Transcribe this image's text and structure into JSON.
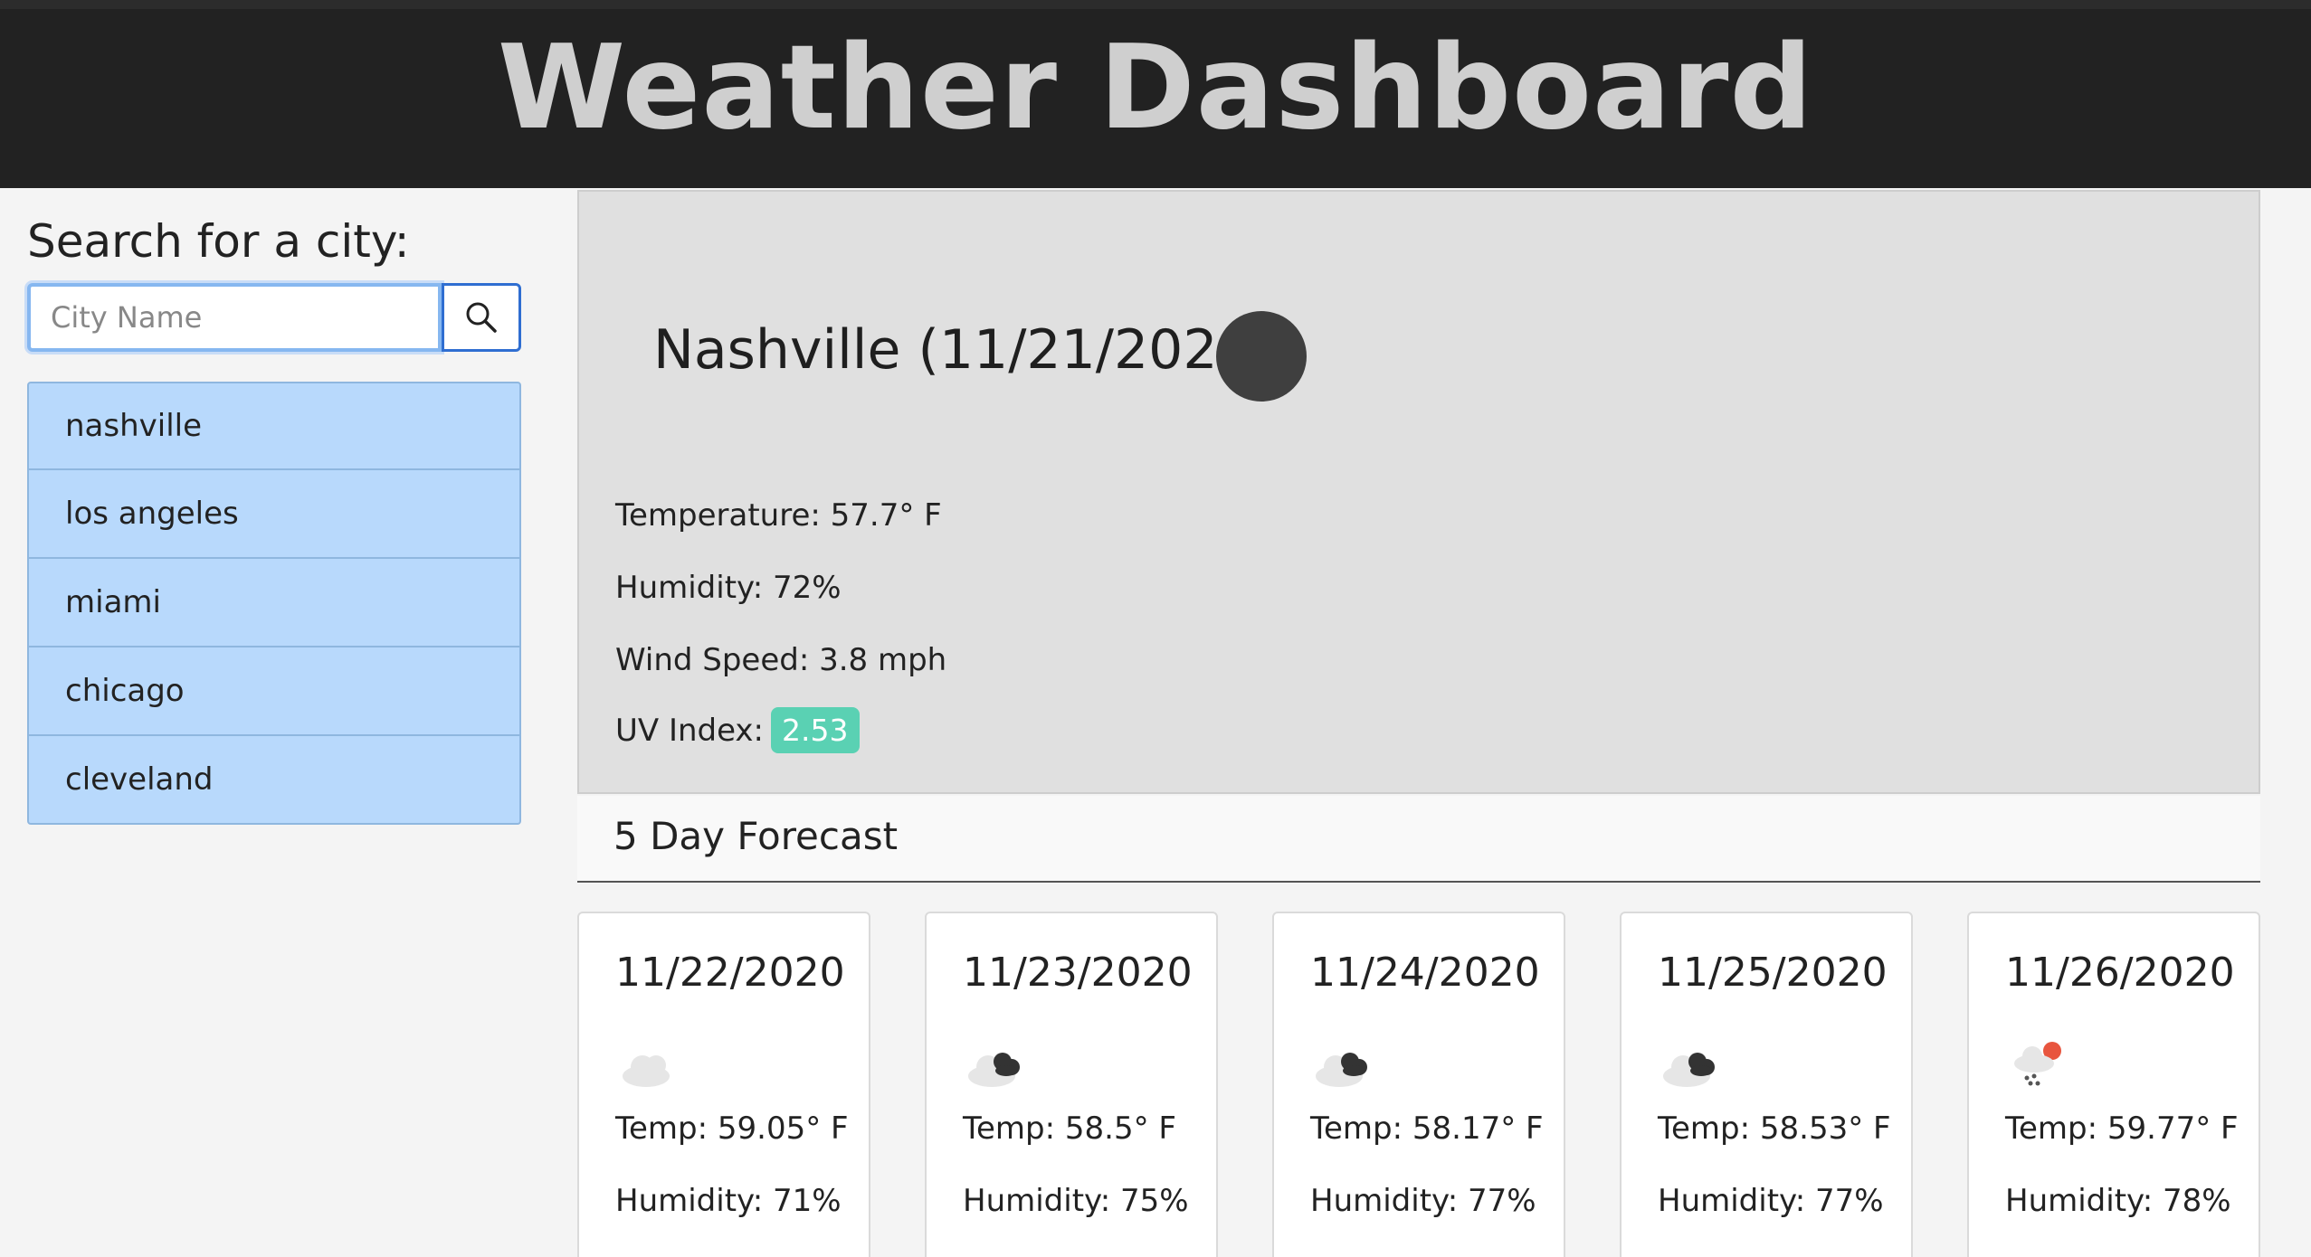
{
  "header": {
    "title": "Weather Dashboard"
  },
  "search": {
    "label": "Search for a city:",
    "placeholder": "City Name",
    "value": ""
  },
  "history": [
    {
      "label": "nashville"
    },
    {
      "label": "los angeles"
    },
    {
      "label": "miami"
    },
    {
      "label": "chicago"
    },
    {
      "label": "cleveland"
    }
  ],
  "current": {
    "title": "Nashville (11/21/2020)",
    "icon": "weather-icon",
    "temperature": "Temperature: 57.7° F",
    "humidity": "Humidity: 72%",
    "wind": "Wind Speed: 3.8 mph",
    "uv_label": "UV Index:",
    "uv_value": "2.53",
    "uv_color": "#5ad1b3"
  },
  "forecast": {
    "heading": "5 Day Forecast",
    "days": [
      {
        "date": "11/22/2020",
        "icon": "cloudy-icon",
        "temp": "Temp: 59.05° F",
        "humidity": "Humidity: 71%"
      },
      {
        "date": "11/23/2020",
        "icon": "broken-clouds-icon",
        "temp": "Temp: 58.5° F",
        "humidity": "Humidity: 75%"
      },
      {
        "date": "11/24/2020",
        "icon": "broken-clouds-icon",
        "temp": "Temp: 58.17° F",
        "humidity": "Humidity: 77%"
      },
      {
        "date": "11/25/2020",
        "icon": "broken-clouds-icon",
        "temp": "Temp: 58.53° F",
        "humidity": "Humidity: 77%"
      },
      {
        "date": "11/26/2020",
        "icon": "rain-icon",
        "temp": "Temp: 59.77° F",
        "humidity": "Humidity: 78%"
      }
    ]
  }
}
